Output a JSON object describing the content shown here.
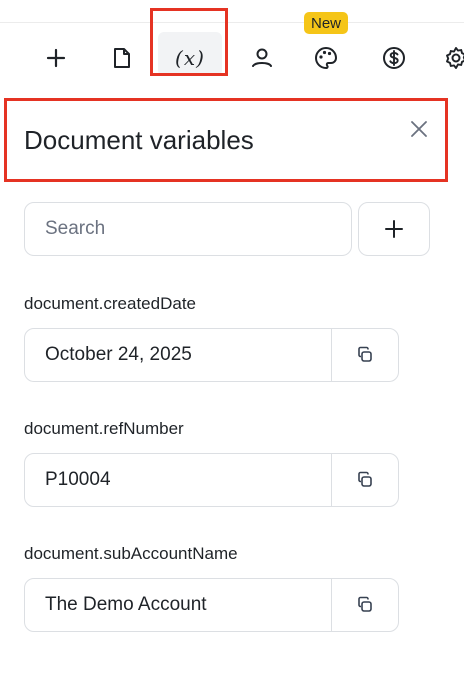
{
  "toolbar": {
    "new_badge": "New",
    "variables_glyph": "(x)",
    "icons": [
      "plus-icon",
      "document-icon",
      "variables-icon",
      "user-icon",
      "palette-icon",
      "dollar-icon",
      "gear-icon"
    ],
    "highlight_color": "#e53323",
    "badge_color": "#f5c518"
  },
  "panel": {
    "title": "Document variables",
    "search": {
      "placeholder": "Search",
      "value": ""
    },
    "variables": [
      {
        "name": "document.createdDate",
        "value": "October 24, 2025"
      },
      {
        "name": "document.refNumber",
        "value": "P10004"
      },
      {
        "name": "document.subAccountName",
        "value": "The Demo Account"
      }
    ]
  }
}
